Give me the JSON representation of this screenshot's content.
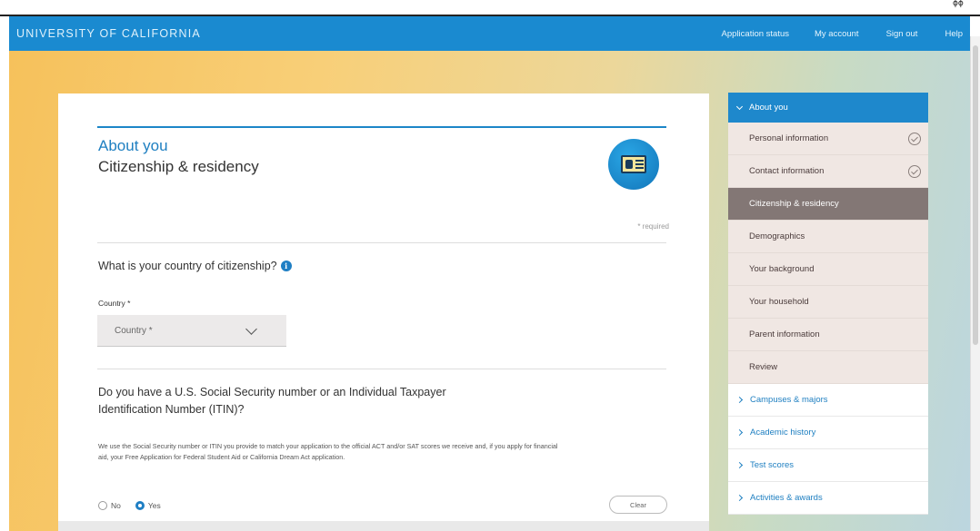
{
  "header": {
    "brand": "UNIVERSITY OF CALIFORNIA",
    "nav": [
      "Application status",
      "My account",
      "Sign out",
      "Help"
    ]
  },
  "corner_mark": "ɸɸ",
  "main": {
    "section_title": "About you",
    "page_title": "Citizenship & residency",
    "required_note": "* required",
    "question1": "What is your country of citizenship?",
    "country_label": "Country *",
    "country_select_value": "Country *",
    "question2": "Do you have a U.S. Social Security number or an Individual Taxpayer Identification Number (ITIN)?",
    "help_text": "We use the Social Security number or ITIN you provide to match your application to the official ACT and/or SAT scores we receive and, if you apply for financial aid, your Free Application for Federal Student Aid or California Dream Act application.",
    "radio_no": "No",
    "radio_yes": "Yes",
    "radio_selected": "Yes",
    "clear_button": "Clear"
  },
  "sidebar": {
    "expanded_group": "About you",
    "sub_items": [
      {
        "label": "Personal information",
        "completed": true
      },
      {
        "label": "Contact information",
        "completed": true
      },
      {
        "label": "Citizenship & residency",
        "active": true
      },
      {
        "label": "Demographics"
      },
      {
        "label": "Your background"
      },
      {
        "label": "Your household"
      },
      {
        "label": "Parent information"
      },
      {
        "label": "Review"
      }
    ],
    "groups": [
      "Campuses & majors",
      "Academic history",
      "Test scores",
      "Activities & awards"
    ]
  },
  "icons": {
    "page_badge": "id-card-icon",
    "info": "info-icon",
    "select_chevron": "chevron-down-icon",
    "completed": "check-circle-icon"
  },
  "colors": {
    "topbar": "#1a8ad0",
    "accent": "#1e7fc1",
    "active_nav": "#837775"
  }
}
